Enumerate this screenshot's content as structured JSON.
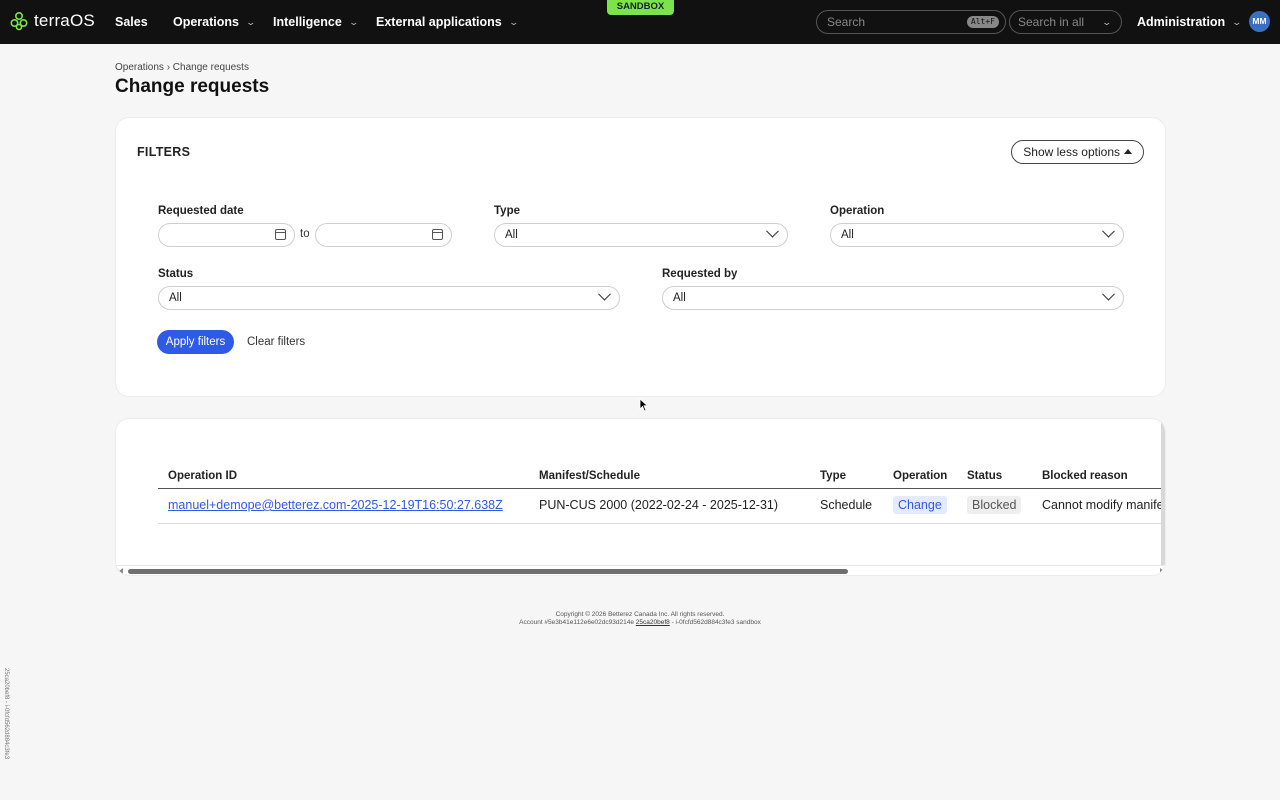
{
  "nav": {
    "logo": "terraOS",
    "items": [
      "Sales",
      "Operations",
      "Intelligence",
      "External applications"
    ],
    "sandbox": "SANDBOX",
    "search_placeholder": "Search",
    "search_shortcut": "Alt+F",
    "scope": "Search in all",
    "admin": "Administration",
    "avatar": "MM"
  },
  "header": {
    "breadcrumb": "Operations › Change requests",
    "title": "Change requests"
  },
  "filters": {
    "heading": "FILTERS",
    "toggle_label": "Show less options",
    "requested_date_label": "Requested date",
    "to_label": "to",
    "type_label": "Type",
    "type_value": "All",
    "operation_label": "Operation",
    "operation_value": "All",
    "status_label": "Status",
    "status_value": "All",
    "requested_by_label": "Requested by",
    "requested_by_value": "All",
    "apply_label": "Apply filters",
    "clear_label": "Clear filters"
  },
  "table": {
    "columns": [
      "Operation ID",
      "Manifest/Schedule",
      "Type",
      "Operation",
      "Status",
      "Blocked reason"
    ],
    "rows": [
      {
        "operation_id": "manuel+demope@betterez.com-2025-12-19T16:50:27.638Z",
        "manifest": "PUN-CUS 2000 (2022-02-24 - 2025-12-31)",
        "type": "Schedule",
        "operation": "Change",
        "status": "Blocked",
        "blocked_reason": "Cannot modify manifest"
      }
    ]
  },
  "footer": {
    "copyright": "Copyright © 2026 Betterez Canada Inc. All rights reserved.",
    "account_prefix": "Account #5e3b41e112e6e02dc93d214e",
    "account_link": "25ca20bef8",
    "account_suffix": "- i-0fcfd562d884c3fe3 sandbox"
  },
  "side_id": "25ca20bef8 - i-0fcfd562d884c3fe3",
  "colors": {
    "primary": "#2f5ae6",
    "sandbox": "#7ce34a",
    "topbar": "#111111"
  }
}
